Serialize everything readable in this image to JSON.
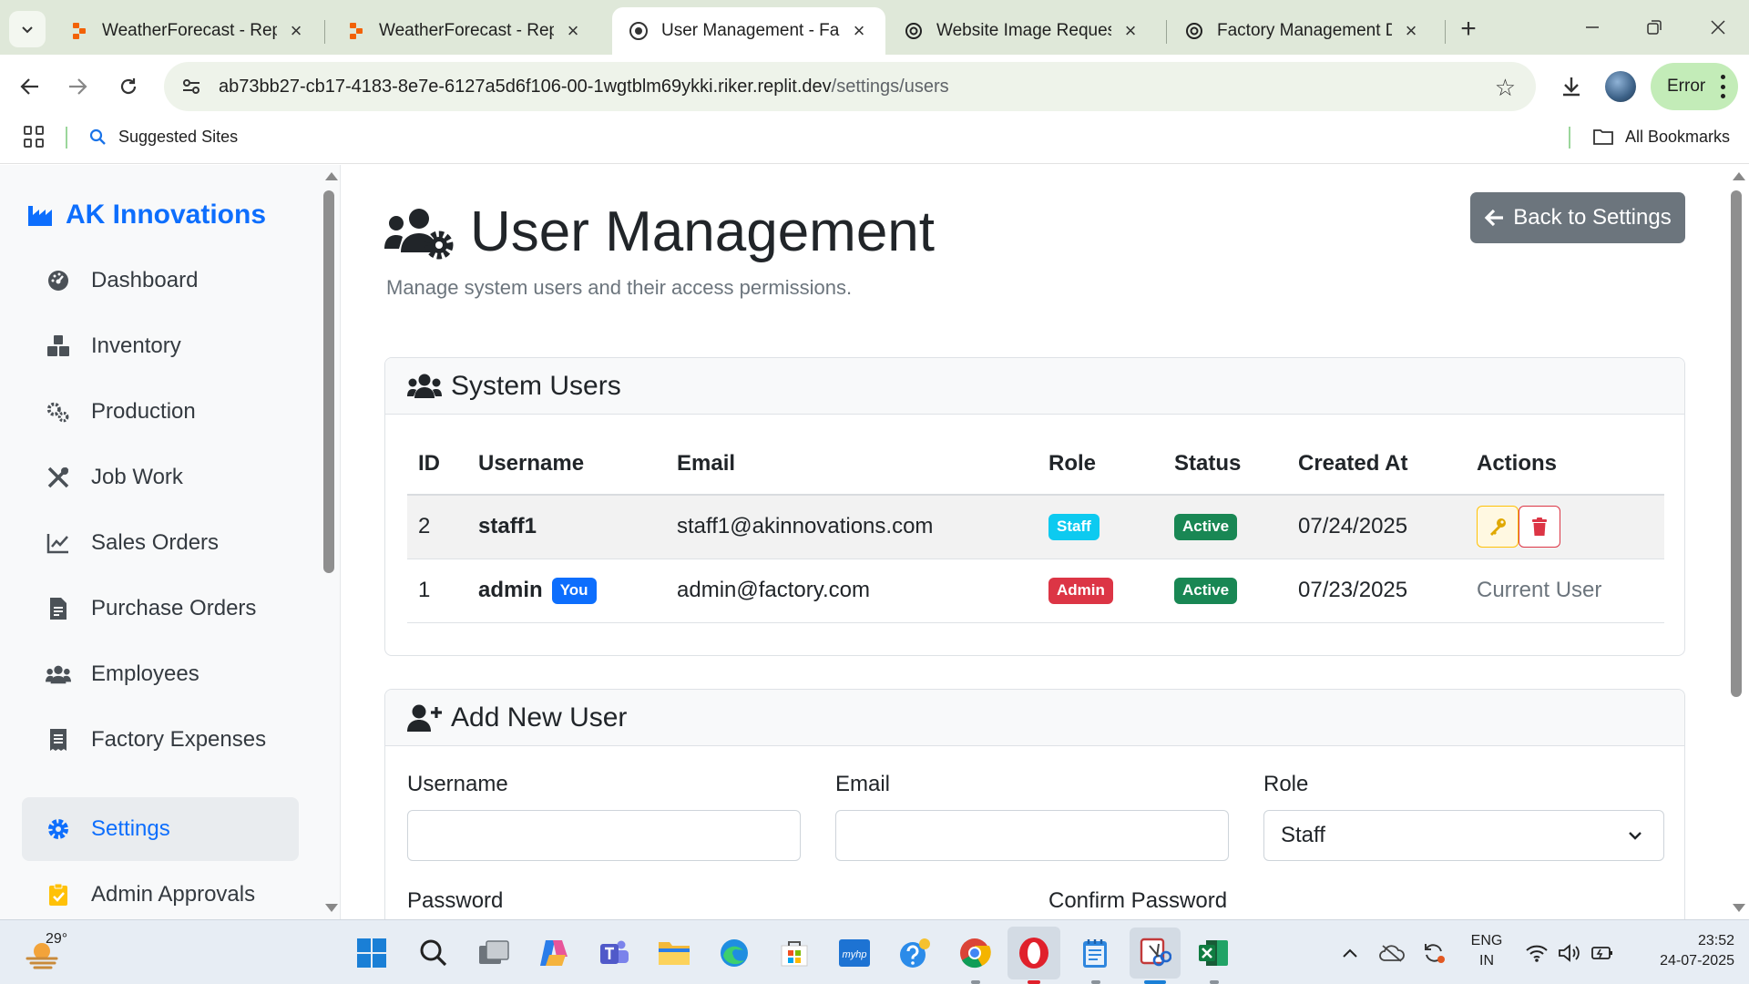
{
  "browser": {
    "tabs": [
      {
        "title": "WeatherForecast - Replit",
        "icon": "replit-icon",
        "active": false
      },
      {
        "title": "WeatherForecast - Replit",
        "icon": "replit-icon",
        "active": false
      },
      {
        "title": "User Management - Fact",
        "icon": "globe-icon",
        "active": true
      },
      {
        "title": "Website Image Request",
        "icon": "chatgpt-icon",
        "active": false
      },
      {
        "title": "Factory Management Dat",
        "icon": "chatgpt-icon",
        "active": false
      }
    ],
    "url_host": "ab73bb27-cb17-4183-8e7e-6127a5d6f106-00-1wgtblm69ykki.riker.replit.dev",
    "url_path": "/settings/users",
    "profile_status": "Error",
    "bookmarks": {
      "suggested": "Suggested Sites",
      "all": "All Bookmarks"
    }
  },
  "brand": {
    "name": "AK Innovations"
  },
  "sidebar": {
    "items": [
      {
        "label": "Dashboard",
        "icon": "gauge-icon"
      },
      {
        "label": "Inventory",
        "icon": "boxes-icon"
      },
      {
        "label": "Production",
        "icon": "cogs-icon"
      },
      {
        "label": "Job Work",
        "icon": "tools-icon"
      },
      {
        "label": "Sales Orders",
        "icon": "chart-line-icon"
      },
      {
        "label": "Purchase Orders",
        "icon": "file-invoice-icon"
      },
      {
        "label": "Employees",
        "icon": "users-icon"
      },
      {
        "label": "Factory Expenses",
        "icon": "receipt-icon"
      },
      {
        "label": "Settings",
        "icon": "gear-icon",
        "active": true
      },
      {
        "label": "Admin Approvals",
        "icon": "clipboard-check-icon"
      }
    ]
  },
  "page": {
    "title": "User Management",
    "subtitle": "Manage system users and their access permissions.",
    "back_button": "Back to Settings"
  },
  "users_card": {
    "title": "System Users",
    "columns": [
      "ID",
      "Username",
      "Email",
      "Role",
      "Status",
      "Created At",
      "Actions"
    ],
    "rows": [
      {
        "id": "2",
        "username": "staff1",
        "is_you": "",
        "email": "staff1@akinnovations.com",
        "role": "Staff",
        "status": "Active",
        "created_at": "07/24/2025",
        "action_text": ""
      },
      {
        "id": "1",
        "username": "admin",
        "is_you": "You",
        "email": "admin@factory.com",
        "role": "Admin",
        "status": "Active",
        "created_at": "07/23/2025",
        "action_text": "Current User"
      }
    ]
  },
  "add_user_card": {
    "title": "Add New User",
    "username_label": "Username",
    "username_value": "",
    "email_label": "Email",
    "email_value": "",
    "role_label": "Role",
    "role_value": "Staff",
    "password_label": "Password",
    "confirm_password_label": "Confirm Password"
  },
  "colors": {
    "primary": "#0d6efd",
    "secondary": "#6c757d",
    "info": "#0dcaf0",
    "danger": "#dc3545",
    "success": "#198754",
    "warning": "#ffc107"
  },
  "taskbar": {
    "weather_temp": "29°",
    "lang_line1": "ENG",
    "lang_line2": "IN",
    "time": "23:52",
    "date": "24-07-2025"
  }
}
